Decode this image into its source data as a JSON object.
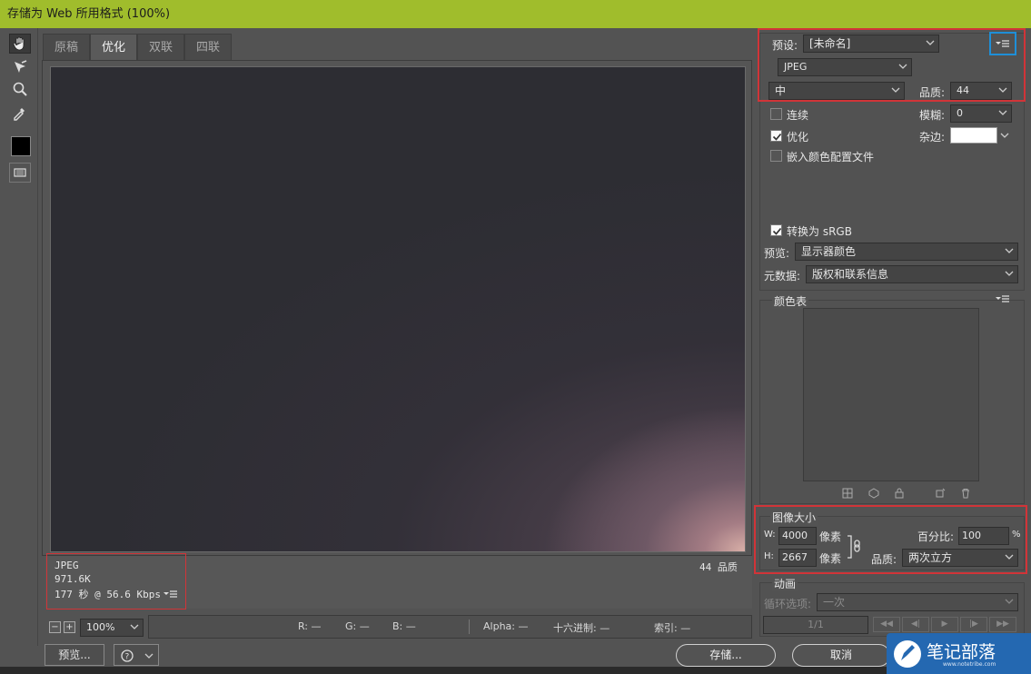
{
  "window": {
    "title": "存储为 Web 所用格式 (100%)"
  },
  "tabs": [
    "原稿",
    "优化",
    "双联",
    "四联"
  ],
  "active_tab": 1,
  "canvas_info": {
    "format": "JPEG",
    "size": "971.6K",
    "time": "177 秒 @ 56.6 Kbps",
    "quality_label": "44 品质"
  },
  "bottom": {
    "zoom": "100%",
    "r_label": "R: —",
    "g_label": "G: —",
    "b_label": "B: —",
    "alpha_label": "Alpha: —",
    "hex_label": "十六进制: —",
    "index_label": "索引: —",
    "preview_button": "预览...",
    "save_button": "存储...",
    "cancel_button": "取消"
  },
  "settings": {
    "preset_label": "预设:",
    "preset_value": "[未命名]",
    "format_value": "JPEG",
    "compression_value": "中",
    "quality_label": "品质:",
    "quality_value": "44",
    "progressive_label": "连续",
    "blur_label": "模糊:",
    "blur_value": "0",
    "optimized_label": "优化",
    "matte_label": "杂边:",
    "embed_profile_label": "嵌入颜色配置文件",
    "convert_srgb_label": "转换为 sRGB",
    "preview_label": "预览:",
    "preview_value": "显示器颜色",
    "metadata_label": "元数据:",
    "metadata_value": "版权和联系信息",
    "progressive_checked": false,
    "optimized_checked": true,
    "embed_profile_checked": false,
    "convert_srgb_checked": true
  },
  "color_table": {
    "title": "颜色表"
  },
  "image_size": {
    "title": "图像大小",
    "w_label": "W:",
    "w_value": "4000",
    "h_label": "H:",
    "h_value": "2667",
    "unit": "像素",
    "percent_label": "百分比:",
    "percent_value": "100",
    "percent_unit": "%",
    "quality_label": "品质:",
    "quality_value": "两次立方"
  },
  "animation": {
    "title": "动画",
    "loop_label": "循环选项:",
    "loop_value": "一次",
    "frame_counter": "1/1"
  },
  "watermark": {
    "name": "笔记部落",
    "url": "www.notetribe.com"
  },
  "colors": {
    "title_bar": "#a0bd2c",
    "panel": "#535353",
    "highlight_red": "#d13438",
    "highlight_blue": "#1e8fd8"
  }
}
